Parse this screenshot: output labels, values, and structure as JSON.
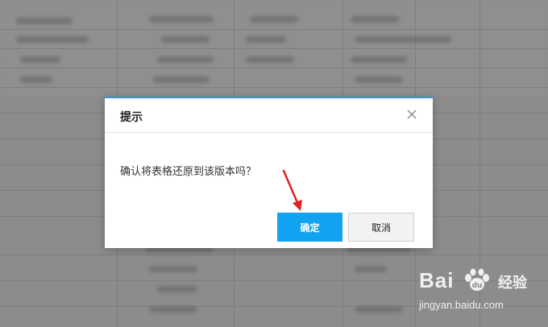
{
  "dialog": {
    "title": "提示",
    "message": "确认将表格还原到该版本吗？",
    "confirm_label": "确定",
    "cancel_label": "取消",
    "accent_color": "#12a3f0"
  },
  "watermark": {
    "brand": "Bai",
    "brand_suffix": "经验",
    "url": "jingyan.baidu.com"
  },
  "annotation": {
    "arrow_color": "#e02020"
  }
}
